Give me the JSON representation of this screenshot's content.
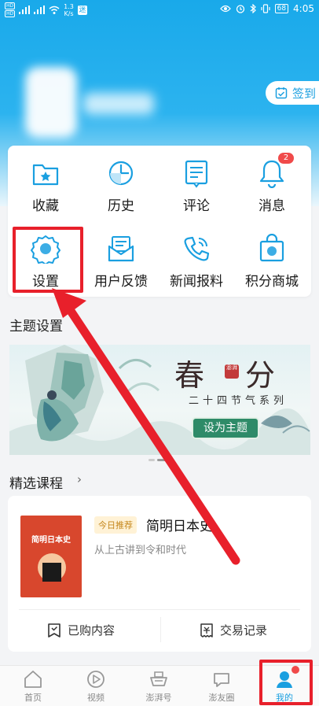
{
  "status_bar": {
    "network_1": "HD",
    "network_2": "HD",
    "speed_value": "1.3",
    "speed_unit": "K/s",
    "time": "4:05",
    "battery": "68"
  },
  "header": {
    "checkin_label": "签到"
  },
  "quick_grid": {
    "items": [
      {
        "label": "收藏",
        "icon": "star-folder-icon"
      },
      {
        "label": "历史",
        "icon": "clock-history-icon"
      },
      {
        "label": "评论",
        "icon": "comment-note-icon"
      },
      {
        "label": "消息",
        "icon": "bell-icon",
        "badge": "2"
      },
      {
        "label": "设置",
        "icon": "gear-icon"
      },
      {
        "label": "用户反馈",
        "icon": "feedback-mail-icon"
      },
      {
        "label": "新闻报料",
        "icon": "phone-call-icon"
      },
      {
        "label": "积分商城",
        "icon": "gift-bag-icon"
      }
    ]
  },
  "theme": {
    "section_title": "主题设置",
    "banner_title_1": "春",
    "banner_title_2": "分",
    "banner_seal": "澎湃",
    "banner_subtitle": "二十四节气系列",
    "apply_button": "设为主题"
  },
  "courses": {
    "section_title": "精选课程",
    "arrow": "›",
    "tag": "今日推荐",
    "name": "简明日本史",
    "description": "从上古讲到令和时代",
    "book_cover_title": "简明日本史",
    "purchased_label": "已购内容",
    "transactions_label": "交易记录"
  },
  "tab_bar": {
    "tabs": [
      {
        "label": "首页",
        "icon": "home-icon"
      },
      {
        "label": "视频",
        "icon": "play-icon"
      },
      {
        "label": "澎湃号",
        "icon": "ship-icon"
      },
      {
        "label": "澎友圈",
        "icon": "chat-bubble-icon"
      },
      {
        "label": "我的",
        "icon": "profile-icon"
      }
    ]
  },
  "colors": {
    "brand_blue": "#1a9fe0",
    "badge_red": "#f04a4a",
    "annotation_red": "#e8202b",
    "theme_green": "#2e8b68"
  }
}
